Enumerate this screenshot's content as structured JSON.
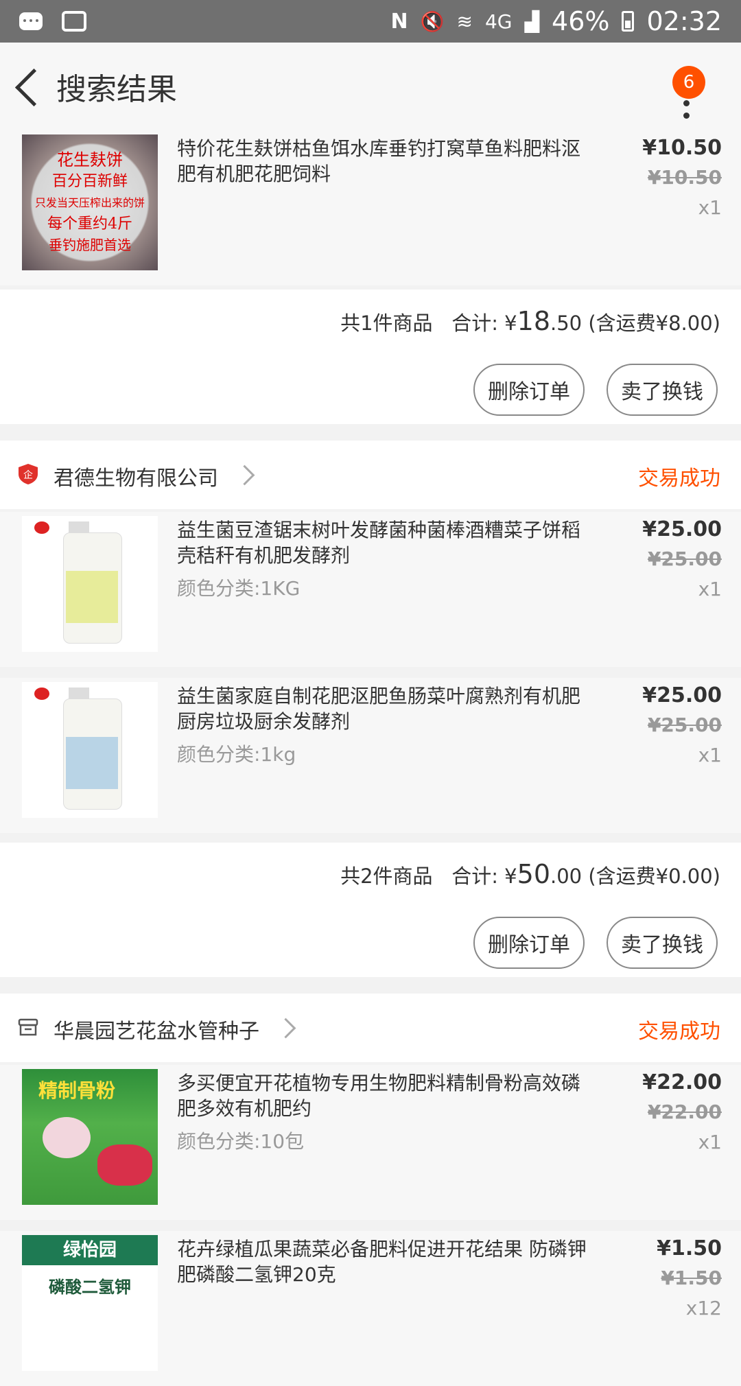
{
  "status_bar": {
    "network": "4G",
    "battery": "46%",
    "time": "02:32"
  },
  "header": {
    "title": "搜索结果",
    "badge": "6"
  },
  "orders": [
    {
      "items": [
        {
          "title": "特价花生麸饼枯鱼饵水库垂钓打窝草鱼料肥料沤肥有机肥花肥饲料",
          "sku": "",
          "price": "¥10.50",
          "orig": "¥10.50",
          "qty": "x1",
          "thumb_text": [
            "花生麸饼",
            "百分百新鲜",
            "只发当天压榨出来的饼",
            "每个重约4斤",
            "垂钓施肥首选"
          ]
        }
      ],
      "summary": {
        "count": "共1件商品",
        "total_label": "合计: ¥",
        "total_big": "18",
        "total_small": ".50",
        "shipping": "(含运费¥8.00)"
      },
      "buttons": {
        "delete": "删除订单",
        "resell": "卖了换钱"
      }
    },
    {
      "shop": {
        "name": "君德生物有限公司",
        "status": "交易成功",
        "icon": "enterprise-shield-icon"
      },
      "items": [
        {
          "title": "益生菌豆渣锯末树叶发酵菌种菌棒酒糟菜子饼稻壳秸秆有机肥发酵剂",
          "sku": "颜色分类:1KG",
          "price": "¥25.00",
          "orig": "¥25.00",
          "qty": "x1"
        },
        {
          "title": "益生菌家庭自制花肥沤肥鱼肠菜叶腐熟剂有机肥厨房垃圾厨余发酵剂",
          "sku": "颜色分类:1kg",
          "price": "¥25.00",
          "orig": "¥25.00",
          "qty": "x1"
        }
      ],
      "summary": {
        "count": "共2件商品",
        "total_label": "合计: ¥",
        "total_big": "50",
        "total_small": ".00",
        "shipping": "(含运费¥0.00)"
      },
      "buttons": {
        "delete": "删除订单",
        "resell": "卖了换钱"
      }
    },
    {
      "shop": {
        "name": "华晨园艺花盆水管种子",
        "status": "交易成功",
        "icon": "store-icon"
      },
      "items": [
        {
          "title": "多买便宜开花植物专用生物肥料精制骨粉高效磷肥多效有机肥约",
          "sku": "颜色分类:10包",
          "price": "¥22.00",
          "orig": "¥22.00",
          "qty": "x1",
          "thumb_text": [
            "精制骨粉"
          ]
        },
        {
          "title": "花卉绿植瓜果蔬菜必备肥料促进开花结果 防磷钾肥磷酸二氢钾20克",
          "sku": "",
          "price": "¥1.50",
          "orig": "¥1.50",
          "qty": "x12",
          "thumb_text": [
            "绿怡园",
            "磷酸二氢钾"
          ]
        }
      ]
    }
  ]
}
